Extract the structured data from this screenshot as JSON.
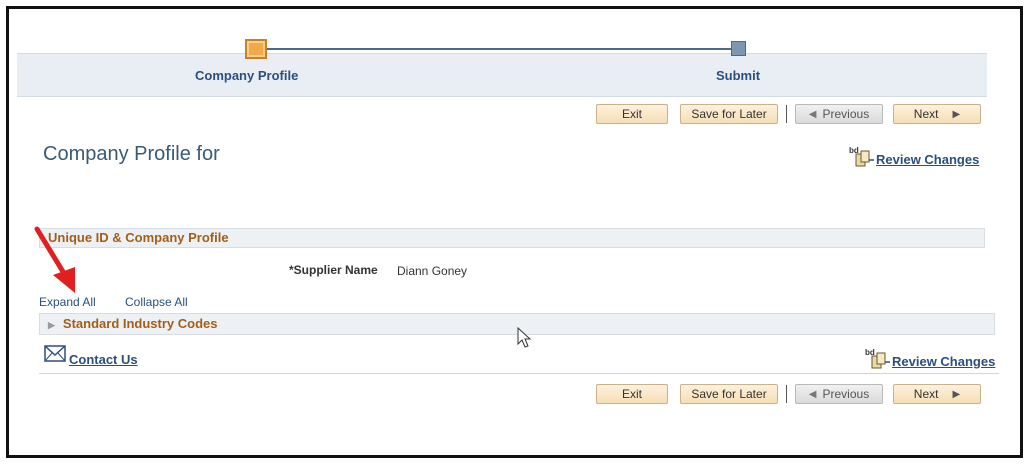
{
  "train": {
    "steps": [
      {
        "label": "Company Profile",
        "state": "current"
      },
      {
        "label": "Submit",
        "state": "upcoming"
      }
    ]
  },
  "toolbar": {
    "exit_label": "Exit",
    "save_label": "Save for Later",
    "previous_label": "Previous",
    "next_label": "Next"
  },
  "page": {
    "title": "Company Profile for",
    "review_changes": "Review Changes"
  },
  "section": {
    "title": "Unique ID & Company Profile",
    "supplier_label": "*Supplier Name",
    "supplier_value": "Diann Goney"
  },
  "links": {
    "expand_all": "Expand All",
    "collapse_all": "Collapse All"
  },
  "sic": {
    "title": "Standard Industry Codes"
  },
  "footer": {
    "contact_us": "Contact Us",
    "review_changes": "Review Changes"
  },
  "colors": {
    "accent_orange": "#f3a94a",
    "link_blue": "#2b4f7e",
    "section_text": "#a15f1a",
    "annotation_red": "#e02020"
  }
}
